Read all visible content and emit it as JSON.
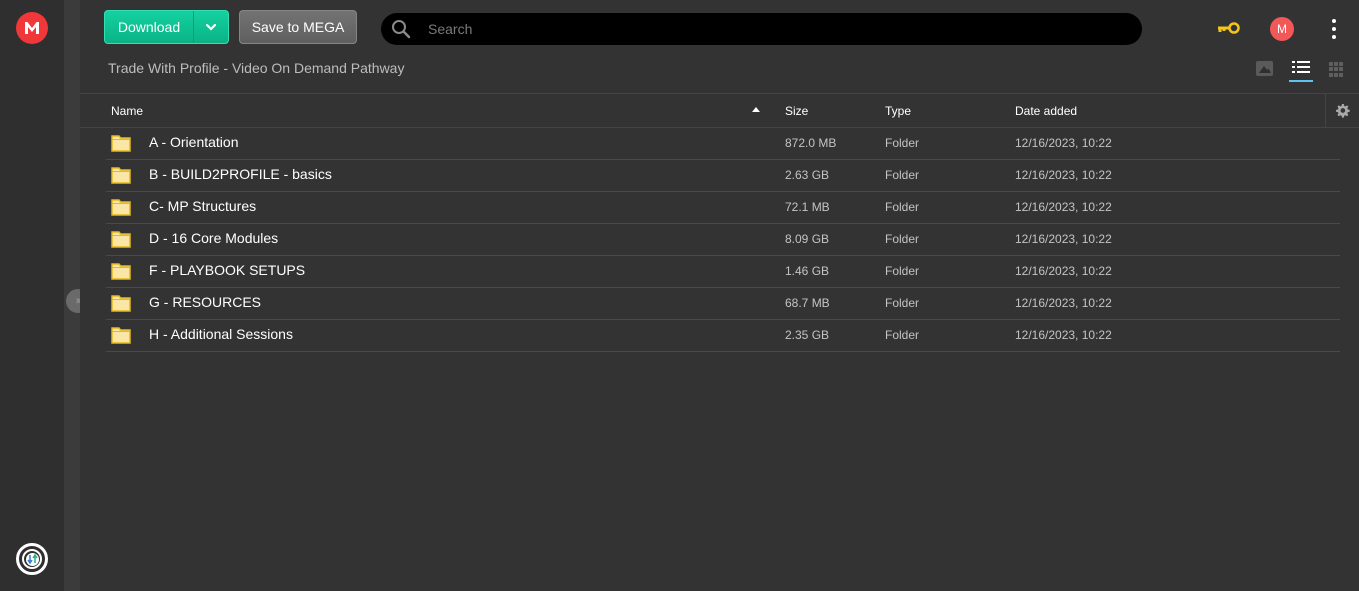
{
  "app": {
    "logo_letter": "M",
    "brand_color": "#f0373a",
    "accent_color": "#0fc394"
  },
  "toolbar": {
    "download_label": "Download",
    "save_label": "Save to MEGA",
    "search_placeholder": "Search",
    "search_value": "",
    "avatar_letter": "M"
  },
  "breadcrumb": {
    "title": "Trade With Profile - Video On Demand Pathway"
  },
  "view_modes": [
    {
      "name": "thumbnail",
      "icon": "image-icon",
      "active": false
    },
    {
      "name": "list",
      "icon": "list-icon",
      "active": true
    },
    {
      "name": "grid",
      "icon": "grid-icon",
      "active": false
    }
  ],
  "table": {
    "columns": {
      "name": "Name",
      "size": "Size",
      "type": "Type",
      "date": "Date added"
    },
    "sort": {
      "column": "name",
      "direction": "ascending"
    },
    "rows": [
      {
        "name": "A - Orientation",
        "size": "872.0 MB",
        "type": "Folder",
        "date": "12/16/2023, 10:22"
      },
      {
        "name": "B - BUILD2PROFILE - basics",
        "size": "2.63 GB",
        "type": "Folder",
        "date": "12/16/2023, 10:22"
      },
      {
        "name": "C- MP Structures",
        "size": "72.1 MB",
        "type": "Folder",
        "date": "12/16/2023, 10:22"
      },
      {
        "name": "D - 16 Core Modules",
        "size": "8.09 GB",
        "type": "Folder",
        "date": "12/16/2023, 10:22"
      },
      {
        "name": "F - PLAYBOOK SETUPS",
        "size": "1.46 GB",
        "type": "Folder",
        "date": "12/16/2023, 10:22"
      },
      {
        "name": "G - RESOURCES",
        "size": "68.7 MB",
        "type": "Folder",
        "date": "12/16/2023, 10:22"
      },
      {
        "name": "H - Additional Sessions",
        "size": "2.35 GB",
        "type": "Folder",
        "date": "12/16/2023, 10:22"
      }
    ]
  }
}
